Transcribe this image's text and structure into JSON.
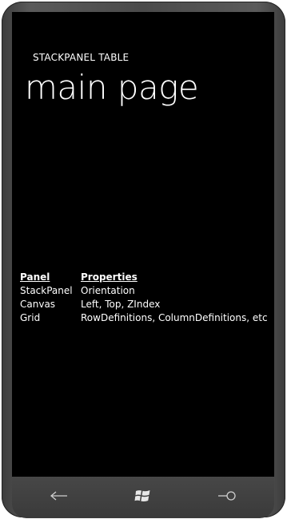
{
  "app": {
    "title": "STACKPANEL TABLE",
    "page_title": "main page"
  },
  "table": {
    "headers": [
      "Panel",
      "Properties"
    ],
    "rows": [
      [
        "StackPanel",
        "Orientation"
      ],
      [
        "Canvas",
        "Left, Top, ZIndex"
      ],
      [
        "Grid",
        "RowDefinitions, ColumnDefinitions, etc"
      ]
    ]
  },
  "nav": {
    "buttons": [
      {
        "icon": "back-arrow-icon"
      },
      {
        "icon": "windows-logo-icon"
      },
      {
        "icon": "search-icon"
      }
    ]
  },
  "colors": {
    "background": "#000000",
    "text": "#ffffff",
    "bezel": "#4a4a4a",
    "nav_icon": "#cfcfcf"
  }
}
